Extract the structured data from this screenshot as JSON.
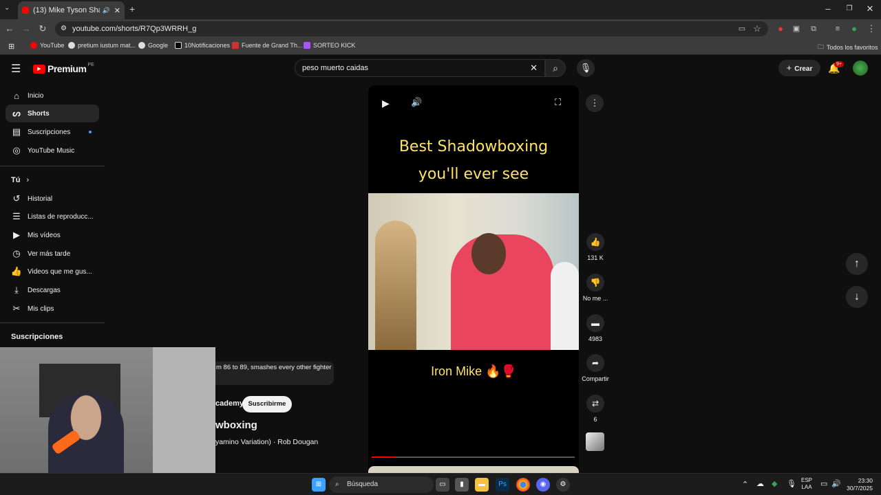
{
  "browser": {
    "tab_title": "(13) Mike Tyson Shadowbo",
    "url": "youtube.com/shorts/R7Qp3WRRH_g",
    "bookmarks": [
      "YouTube",
      "pretium iustum mat...",
      "Google",
      "10Notificaciones",
      "Fuente de Grand Th...",
      "SORTEO KICK"
    ],
    "all_bookmarks": "Todos los favoritos"
  },
  "youtube": {
    "logo": "Premium",
    "region": "PE",
    "search_value": "peso muerto caidas",
    "create_label": "Crear",
    "notif_count": "9+"
  },
  "sidebar": {
    "main": [
      {
        "label": "Inicio",
        "icon": "home-icon"
      },
      {
        "label": "Shorts",
        "icon": "shorts-icon"
      },
      {
        "label": "Suscripciones",
        "icon": "subscriptions-icon"
      },
      {
        "label": "YouTube Music",
        "icon": "music-icon"
      }
    ],
    "you_title": "Tú",
    "you": [
      {
        "label": "Historial",
        "icon": "history-icon"
      },
      {
        "label": "Listas de reproducc...",
        "icon": "playlist-icon"
      },
      {
        "label": "Mis vídeos",
        "icon": "video-icon"
      },
      {
        "label": "Ver más tarde",
        "icon": "clock-icon"
      },
      {
        "label": "Videos que me gus...",
        "icon": "like-icon"
      },
      {
        "label": "Descargas",
        "icon": "download-icon"
      },
      {
        "label": "Mis clips",
        "icon": "scissors-icon"
      }
    ],
    "subs_title": "Suscripciones"
  },
  "video": {
    "caption_line1": "Best Shadowboxing",
    "caption_line2": "you'll ever see",
    "caption_bottom": "Iron Mike 🔥🥊",
    "progress_fraction": 0.12
  },
  "overlay": {
    "desc": "m 86 to 89, smashes every other fighter",
    "channel": "cademy",
    "subscribe": "Suscribirme",
    "title": "wboxing",
    "music": "yamino Variation) · Rob Dougan"
  },
  "actions": {
    "likes": "131 K",
    "dislike": "No me ...",
    "comments": "4983",
    "share": "Compartir",
    "remix": "6"
  },
  "taskbar": {
    "search": "Búsqueda",
    "lang1": "ESP",
    "lang2": "LAA",
    "time": "23:30",
    "date": "30/7/2025"
  }
}
